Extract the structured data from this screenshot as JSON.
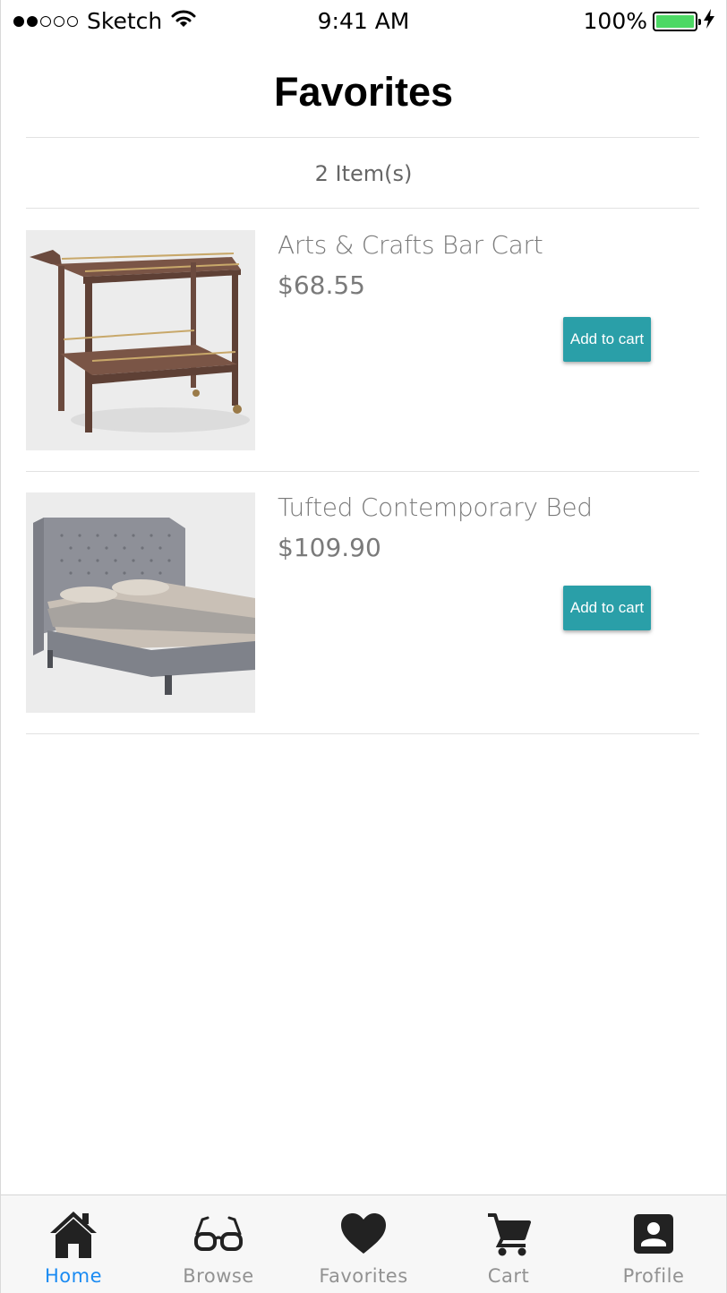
{
  "status_bar": {
    "carrier": "Sketch",
    "time": "9:41 AM",
    "battery": "100%",
    "signal_dots": [
      true,
      true,
      false,
      false,
      false
    ],
    "battery_color": "#4cd964"
  },
  "header": {
    "title": "Favorites",
    "item_count": "2 Item(s)"
  },
  "products": [
    {
      "name": "Arts & Crafts Bar Cart",
      "price": "$68.55",
      "button_label": "Add to cart",
      "image": "bar-cart-image"
    },
    {
      "name": "Tufted Contemporary Bed",
      "price": "$109.90",
      "button_label": "Add to cart",
      "image": "tufted-bed-image"
    }
  ],
  "tab_bar": {
    "active_color": "#1b8bf2",
    "tabs": [
      {
        "label": "Home",
        "icon": "home-icon",
        "active": true
      },
      {
        "label": "Browse",
        "icon": "glasses-icon",
        "active": false
      },
      {
        "label": "Favorites",
        "icon": "heart-icon",
        "active": false
      },
      {
        "label": "Cart",
        "icon": "cart-icon",
        "active": false
      },
      {
        "label": "Profile",
        "icon": "profile-icon",
        "active": false
      }
    ]
  },
  "accent_color": "#2a9fa8"
}
